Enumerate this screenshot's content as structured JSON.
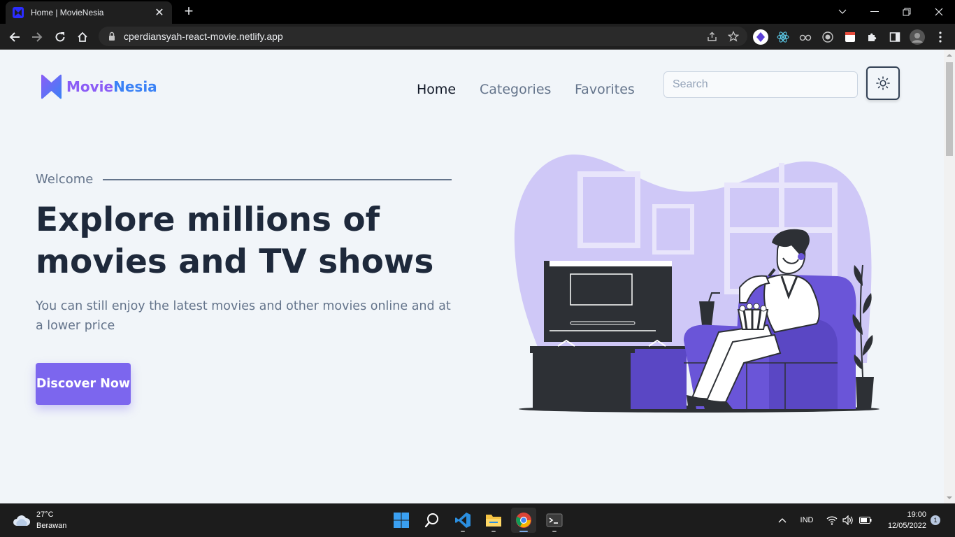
{
  "browser": {
    "tab_title": "Home | MovieNesia",
    "new_tab": "+",
    "url": "cperdiansyah-react-movie.netlify.app"
  },
  "site": {
    "logo_part1": "Movie",
    "logo_part2": "Nesia",
    "nav": [
      "Home",
      "Categories",
      "Favorites"
    ],
    "search_placeholder": "Search"
  },
  "hero": {
    "welcome": "Welcome",
    "headline": "Explore millions of movies and TV shows",
    "subtext": "You can still enjoy the latest movies and other movies online and at a lower price",
    "cta": "Discover Now"
  },
  "taskbar": {
    "weather_temp": "27°C",
    "weather_desc": "Berawan",
    "lang": "IND",
    "time": "19:00",
    "date": "12/05/2022",
    "notifications": "1"
  },
  "colors": {
    "accent": "#7c66ee",
    "page_bg": "#f1f5f9",
    "heading": "#1e293b",
    "muted": "#64748b"
  },
  "icons": {
    "theme_toggle": "sun-icon",
    "browser_toolbar": [
      "back-arrow-icon",
      "forward-arrow-icon",
      "reload-icon",
      "home-icon",
      "lock-icon",
      "share-icon",
      "star-icon",
      "puzzle-icon",
      "sidebar-icon",
      "profile-avatar"
    ]
  }
}
